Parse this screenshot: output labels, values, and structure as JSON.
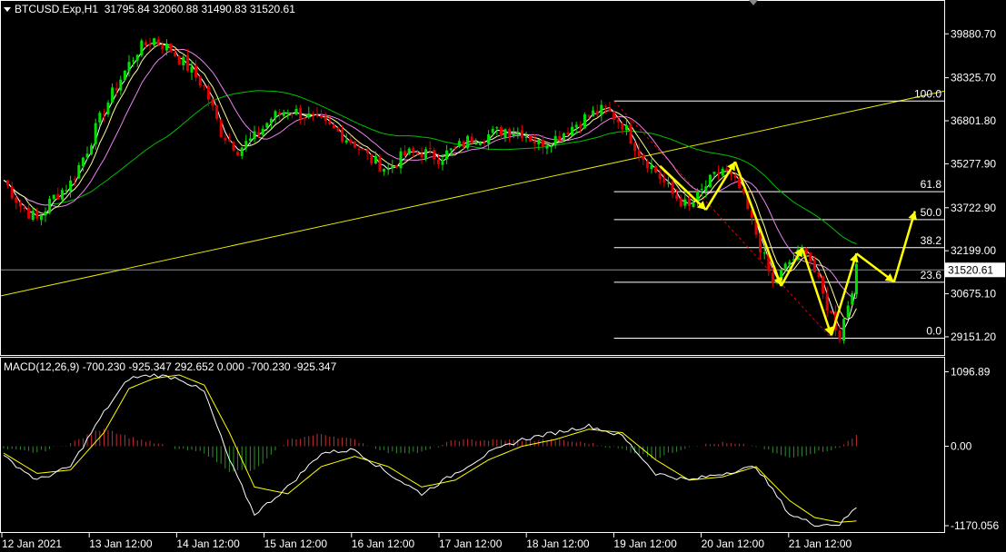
{
  "header": {
    "symbol": "BTCUSD.Exp,H1",
    "ohlc": "31795.84 32060.88 31490.83 31520.61"
  },
  "macd_header": "MACD(12,26,9) -700.230 -925.347 292.652 0.000 -700.230 -925.347",
  "colors": {
    "background": "#000000",
    "bull": "#00e000",
    "bear": "#e00000",
    "ma_fast": "#ffffff",
    "ma_mid": "#ffff99",
    "ma_slow": "#ee82ee",
    "ma_long": "#00c000",
    "trendline": "#e6e600",
    "arrows": "#ffff00",
    "fib": "#ffffff",
    "macd_line": "#ffffff",
    "signal_line": "#ffff00"
  },
  "price_axis": {
    "ticks": [
      "39880.70",
      "38325.70",
      "36801.80",
      "35277.90",
      "33722.90",
      "32199.00",
      "30675.10",
      "29151.20"
    ],
    "current_price": "31520.61"
  },
  "macd_axis": {
    "ticks": [
      "1096.89",
      "0.00",
      "-1170.056"
    ]
  },
  "time_axis": {
    "labels": [
      "12 Jan 2021",
      "13 Jan 12:00",
      "14 Jan 12:00",
      "15 Jan 12:00",
      "16 Jan 12:00",
      "17 Jan 12:00",
      "18 Jan 12:00",
      "19 Jan 12:00",
      "20 Jan 12:00",
      "21 Jan 12:00"
    ]
  },
  "fibonacci": {
    "levels": [
      "100.0",
      "61.8",
      "50.0",
      "38.2",
      "23.6",
      "0.0"
    ]
  },
  "chart_data": {
    "type": "candlestick",
    "symbol": "BTCUSD.Exp",
    "timeframe": "H1",
    "ohlc_last": {
      "open": 31795.84,
      "high": 32060.88,
      "low": 31490.83,
      "close": 31520.61
    },
    "price_ylim": [
      28700,
      40500
    ],
    "close_path": [
      [
        0,
        34700
      ],
      [
        4,
        33800
      ],
      [
        8,
        33300
      ],
      [
        12,
        34100
      ],
      [
        16,
        34600
      ],
      [
        20,
        35800
      ],
      [
        24,
        37200
      ],
      [
        28,
        38300
      ],
      [
        32,
        39300
      ],
      [
        36,
        39700
      ],
      [
        40,
        39300
      ],
      [
        44,
        38700
      ],
      [
        48,
        38000
      ],
      [
        52,
        36400
      ],
      [
        56,
        35800
      ],
      [
        60,
        36200
      ],
      [
        64,
        36900
      ],
      [
        68,
        37200
      ],
      [
        72,
        37000
      ],
      [
        76,
        36700
      ],
      [
        80,
        36400
      ],
      [
        84,
        36000
      ],
      [
        88,
        35400
      ],
      [
        92,
        35100
      ],
      [
        96,
        35600
      ],
      [
        100,
        35700
      ],
      [
        104,
        35500
      ],
      [
        108,
        35800
      ],
      [
        112,
        36200
      ],
      [
        116,
        36300
      ],
      [
        120,
        36500
      ],
      [
        124,
        36400
      ],
      [
        128,
        36000
      ],
      [
        132,
        36200
      ],
      [
        136,
        36600
      ],
      [
        140,
        37000
      ],
      [
        144,
        37200
      ],
      [
        148,
        36700
      ],
      [
        152,
        35700
      ],
      [
        156,
        35000
      ],
      [
        160,
        34200
      ],
      [
        164,
        33700
      ],
      [
        168,
        34500
      ],
      [
        172,
        35100
      ],
      [
        176,
        34400
      ],
      [
        180,
        32800
      ],
      [
        184,
        31000
      ],
      [
        188,
        31800
      ],
      [
        192,
        32300
      ],
      [
        196,
        30600
      ],
      [
        200,
        29200
      ],
      [
        204,
        31500
      ]
    ],
    "fib_high": 37500,
    "fib_low": 29100,
    "macd": {
      "ylim": [
        -1250,
        1250
      ],
      "macd_path": [
        [
          0,
          -150
        ],
        [
          8,
          -500
        ],
        [
          16,
          -300
        ],
        [
          24,
          500
        ],
        [
          30,
          1000
        ],
        [
          36,
          1050
        ],
        [
          42,
          1000
        ],
        [
          48,
          800
        ],
        [
          54,
          -200
        ],
        [
          60,
          -1000
        ],
        [
          68,
          -600
        ],
        [
          76,
          -100
        ],
        [
          84,
          -50
        ],
        [
          92,
          -400
        ],
        [
          100,
          -700
        ],
        [
          108,
          -400
        ],
        [
          116,
          -100
        ],
        [
          124,
          100
        ],
        [
          132,
          200
        ],
        [
          140,
          300
        ],
        [
          148,
          150
        ],
        [
          156,
          -400
        ],
        [
          164,
          -500
        ],
        [
          172,
          -400
        ],
        [
          180,
          -300
        ],
        [
          188,
          -1000
        ],
        [
          194,
          -1150
        ],
        [
          200,
          -1150
        ],
        [
          204,
          -900
        ]
      ],
      "signal_path": [
        [
          0,
          -100
        ],
        [
          8,
          -400
        ],
        [
          16,
          -350
        ],
        [
          24,
          200
        ],
        [
          30,
          850
        ],
        [
          36,
          1000
        ],
        [
          42,
          1050
        ],
        [
          48,
          900
        ],
        [
          54,
          200
        ],
        [
          60,
          -600
        ],
        [
          68,
          -700
        ],
        [
          76,
          -300
        ],
        [
          84,
          -150
        ],
        [
          92,
          -300
        ],
        [
          100,
          -600
        ],
        [
          108,
          -500
        ],
        [
          116,
          -200
        ],
        [
          124,
          0
        ],
        [
          132,
          100
        ],
        [
          140,
          250
        ],
        [
          148,
          200
        ],
        [
          156,
          -200
        ],
        [
          164,
          -500
        ],
        [
          172,
          -450
        ],
        [
          180,
          -300
        ],
        [
          188,
          -800
        ],
        [
          194,
          -1050
        ],
        [
          200,
          -1120
        ],
        [
          204,
          -1100
        ]
      ]
    }
  }
}
